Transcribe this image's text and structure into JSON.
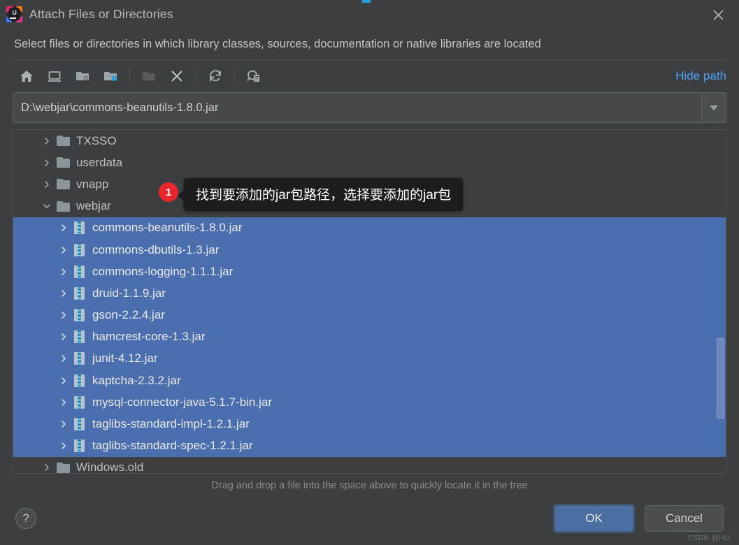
{
  "window": {
    "title": "Attach Files or Directories",
    "app_icon": "intellij-idea-icon",
    "close_icon": "close-icon"
  },
  "subtitle": "Select files or directories in which library classes, sources, documentation or native libraries are located",
  "toolbar": {
    "buttons": [
      {
        "name": "home-icon",
        "tooltip": "Home",
        "enabled": true
      },
      {
        "name": "desktop-icon",
        "tooltip": "Desktop",
        "enabled": true
      },
      {
        "name": "project-folder-icon",
        "tooltip": "Project Directory",
        "enabled": true
      },
      {
        "name": "module-folder-icon",
        "tooltip": "Module Directory",
        "enabled": true
      },
      {
        "name": "new-folder-icon",
        "tooltip": "New Folder",
        "enabled": false
      },
      {
        "name": "delete-icon",
        "tooltip": "Delete",
        "enabled": true
      },
      {
        "name": "refresh-icon",
        "tooltip": "Refresh",
        "enabled": true
      },
      {
        "name": "show-hidden-files-icon",
        "tooltip": "Show Hidden Files and Directories",
        "enabled": true
      }
    ],
    "hide_path_label": "Hide path"
  },
  "path_field": {
    "value": "D:\\webjar\\commons-beanutils-1.8.0.jar",
    "dropdown_icon": "chevron-down-icon"
  },
  "tree": {
    "rows": [
      {
        "label": "TXSSO",
        "icon": "folder-icon",
        "indent": 1,
        "expanded": false,
        "selected": false
      },
      {
        "label": "userdata",
        "icon": "folder-icon",
        "indent": 1,
        "expanded": false,
        "selected": false
      },
      {
        "label": "vnapp",
        "icon": "folder-icon",
        "indent": 1,
        "expanded": false,
        "selected": false
      },
      {
        "label": "webjar",
        "icon": "folder-icon",
        "indent": 1,
        "expanded": true,
        "selected": false
      },
      {
        "label": "commons-beanutils-1.8.0.jar",
        "icon": "jar-icon",
        "indent": 2,
        "expanded": false,
        "selected": true
      },
      {
        "label": "commons-dbutils-1.3.jar",
        "icon": "jar-icon",
        "indent": 2,
        "expanded": false,
        "selected": true
      },
      {
        "label": "commons-logging-1.1.1.jar",
        "icon": "jar-icon",
        "indent": 2,
        "expanded": false,
        "selected": true
      },
      {
        "label": "druid-1.1.9.jar",
        "icon": "jar-icon",
        "indent": 2,
        "expanded": false,
        "selected": true
      },
      {
        "label": "gson-2.2.4.jar",
        "icon": "jar-icon",
        "indent": 2,
        "expanded": false,
        "selected": true
      },
      {
        "label": "hamcrest-core-1.3.jar",
        "icon": "jar-icon",
        "indent": 2,
        "expanded": false,
        "selected": true
      },
      {
        "label": "junit-4.12.jar",
        "icon": "jar-icon",
        "indent": 2,
        "expanded": false,
        "selected": true
      },
      {
        "label": "kaptcha-2.3.2.jar",
        "icon": "jar-icon",
        "indent": 2,
        "expanded": false,
        "selected": true
      },
      {
        "label": "mysql-connector-java-5.1.7-bin.jar",
        "icon": "jar-icon",
        "indent": 2,
        "expanded": false,
        "selected": true
      },
      {
        "label": "taglibs-standard-impl-1.2.1.jar",
        "icon": "jar-icon",
        "indent": 2,
        "expanded": false,
        "selected": true
      },
      {
        "label": "taglibs-standard-spec-1.2.1.jar",
        "icon": "jar-icon",
        "indent": 2,
        "expanded": false,
        "selected": true
      },
      {
        "label": "Windows.old",
        "icon": "folder-icon",
        "indent": 1,
        "expanded": false,
        "selected": false
      }
    ]
  },
  "annotation": {
    "badge": "1",
    "text": "找到要添加的jar包路径，选择要添加的jar包"
  },
  "hint": "Drag and drop a file into the space above to quickly locate it in the tree",
  "footer": {
    "help_label": "?",
    "ok_label": "OK",
    "cancel_label": "Cancel"
  },
  "watermark": "CSDN @HU;",
  "colors": {
    "background": "#3c3f41",
    "selection": "#4b6eaf",
    "link": "#4d9ff5",
    "badge": "#e8262b",
    "ok_button": "#4a6fa0"
  }
}
